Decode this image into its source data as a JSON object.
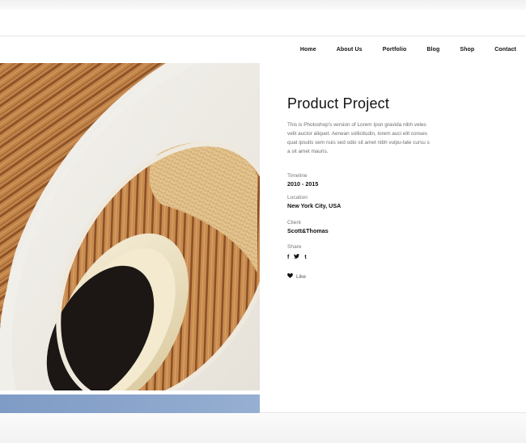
{
  "nav": {
    "items": [
      "Home",
      "About Us",
      "Portfolio",
      "Blog",
      "Shop",
      "Contact"
    ]
  },
  "project": {
    "title": "Product Project",
    "description": "This is Photoshop's version  of Lorem Ipsn gravida nibh veles velit auctor aliquet. Aenean sollicitudin, lorem auci elit conses quat ipsutis sem nuis sed odio sit amet nibh vulpu-tate cursu s a sit amet mauris.",
    "timeline": {
      "label": "Timeline",
      "value": "2010 - 2015"
    },
    "location": {
      "label": "Location",
      "value": "New York City, USA"
    },
    "client": {
      "label": "Client",
      "value": "Scott&Thomas"
    },
    "share": {
      "label": "Share",
      "icons": [
        "facebook-icon",
        "twitter-icon",
        "tumblr-icon"
      ],
      "glyphs": [
        "f",
        "❧",
        "t"
      ]
    },
    "like": {
      "label": "Like",
      "icon": "heart-icon"
    }
  },
  "colors": {
    "strip": "#8aa4cb",
    "wood": "#b77a3f",
    "cream": "#ece8df"
  }
}
